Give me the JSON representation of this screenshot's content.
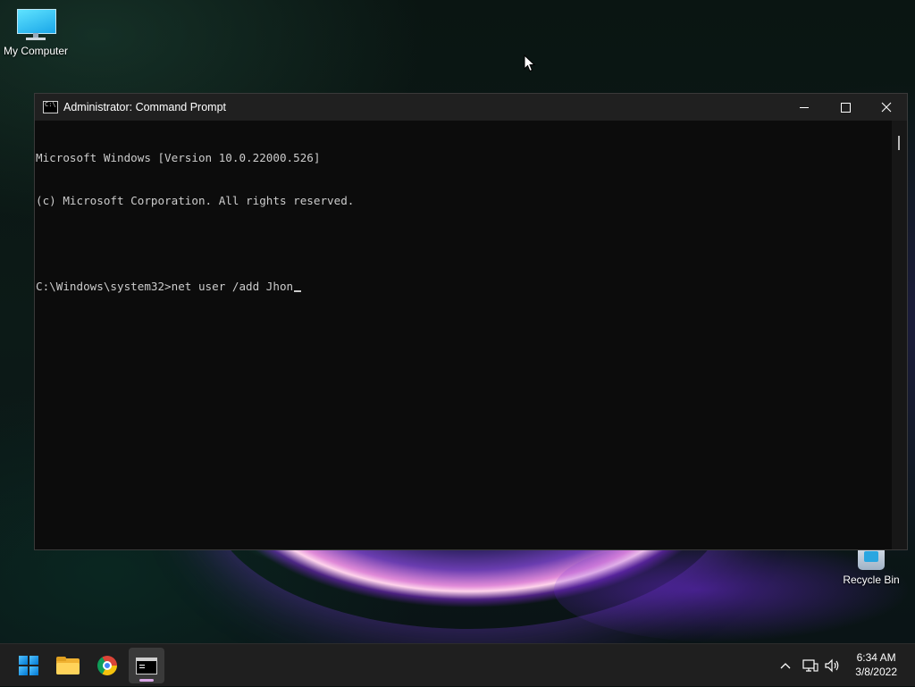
{
  "desktop": {
    "icons": [
      {
        "label": "My Computer",
        "icon": "monitor-icon"
      },
      {
        "label": "Recycle Bin",
        "icon": "recycle-bin-icon"
      }
    ]
  },
  "window": {
    "title": "Administrator: Command Prompt",
    "controls": {
      "minimize": "minimize-icon",
      "maximize": "maximize-icon",
      "close": "close-icon"
    },
    "console_lines": [
      "Microsoft Windows [Version 10.0.22000.526]",
      "(c) Microsoft Corporation. All rights reserved.",
      "",
      "C:\\Windows\\system32>net user /add Jhon"
    ],
    "background": "#0c0c0c",
    "text_color": "#cccccc"
  },
  "taskbar": {
    "apps": [
      {
        "name": "Start",
        "icon": "windows-logo-icon"
      },
      {
        "name": "File Explorer",
        "icon": "folder-icon"
      },
      {
        "name": "Google Chrome",
        "icon": "chrome-icon"
      },
      {
        "name": "Command Prompt",
        "icon": "cmd-icon",
        "active": true
      }
    ],
    "tray": {
      "chevron": "^",
      "network_icon": "network-icon",
      "volume_icon": "volume-icon"
    },
    "clock": {
      "time": "6:34 AM",
      "date": "3/8/2022"
    },
    "accent": "#d9a7e6"
  }
}
